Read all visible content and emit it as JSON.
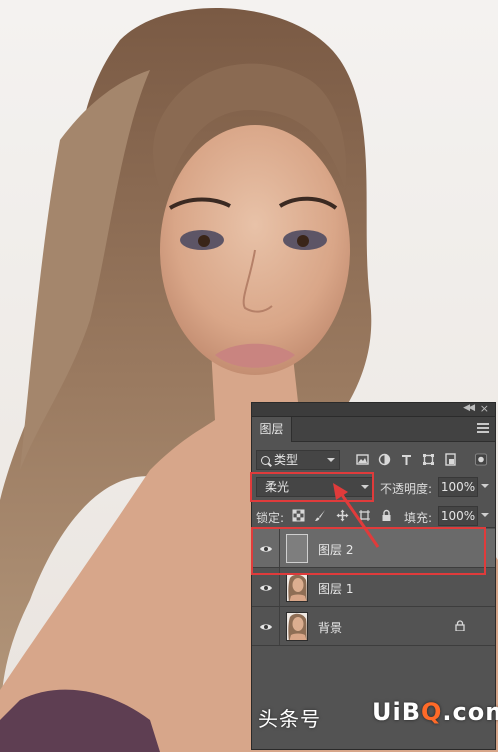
{
  "panel": {
    "tab_label": "图层",
    "filter_kind": "类型",
    "blend_mode": "柔光",
    "opacity_label": "不透明度:",
    "opacity_value": "100%",
    "lock_label": "锁定:",
    "fill_label": "填充:",
    "fill_value": "100%",
    "layers": [
      {
        "name": "图层 2",
        "selected": true,
        "visible": true
      },
      {
        "name": "图层 1",
        "selected": false,
        "visible": true
      },
      {
        "name": "背景",
        "selected": false,
        "visible": true,
        "locked": true
      }
    ]
  },
  "watermark": {
    "text": "头条号",
    "logo_a": "UiB",
    "logo_dot": "Q",
    "logo_b": ".com"
  },
  "colors": {
    "highlight": "#e03b3b",
    "arrow": "#e03b3b",
    "panel_bg": "#535353",
    "selected_layer": "#6a6a6a"
  }
}
